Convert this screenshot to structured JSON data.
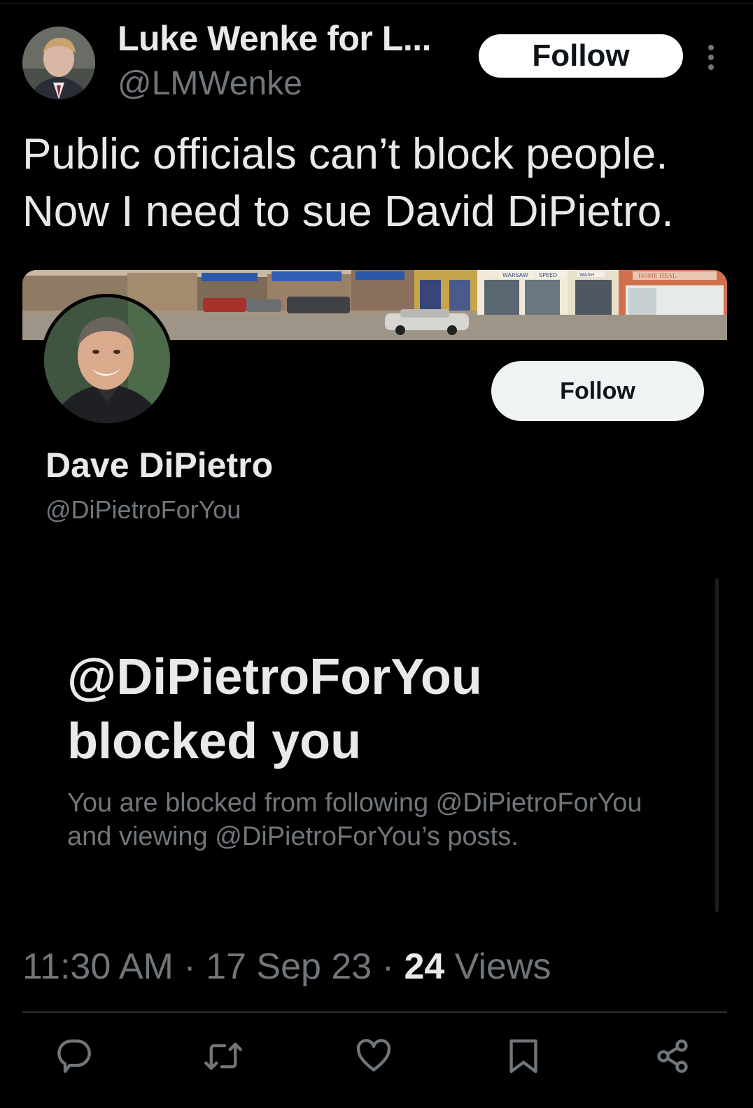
{
  "post": {
    "author_name": "Luke Wenke for L...",
    "author_handle": "@LMWenke",
    "follow_label": "Follow",
    "text_line1": "Public officials can’t block people.",
    "text_line2": "Now I need to sue David DiPietro."
  },
  "embedded_profile": {
    "banner_image": "main-street-storefronts",
    "banner_signs": [
      "WARSAW",
      "SPEED",
      "WASH",
      "HOME HEAL"
    ],
    "name": "Dave DiPietro",
    "handle": "@DiPietroForYou",
    "follow_label": "Follow",
    "blocked_title_line1": "@DiPietroForYou",
    "blocked_title_line2": "blocked you",
    "blocked_desc_line1": "You are blocked from following @DiPietroForYou",
    "blocked_desc_line2": "and viewing @DiPietroForYou’s posts."
  },
  "meta": {
    "time": "11:30 AM",
    "sep1": "·",
    "date": "17 Sep 23",
    "sep2": "·",
    "views_count": "24",
    "views_label": "Views"
  },
  "actions": [
    "reply-icon",
    "repost-icon",
    "like-icon",
    "bookmark-icon",
    "share-icon"
  ],
  "colors": {
    "background": "#000000",
    "primary_text": "#e7e9ea",
    "secondary_text": "#71767b",
    "divider": "#2f3336"
  }
}
